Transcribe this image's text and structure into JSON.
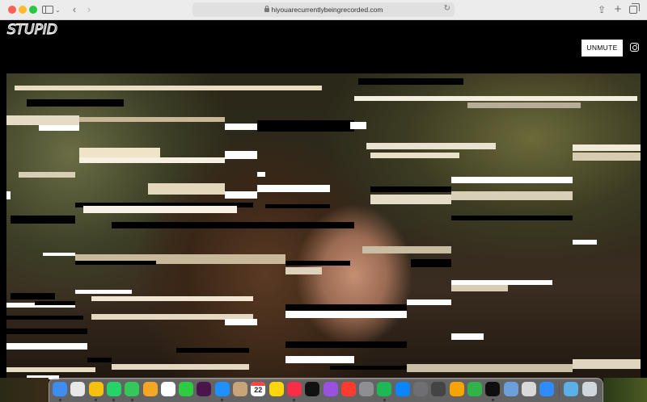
{
  "browser": {
    "url": "hiyouarecurrentlybeingrecorded.com"
  },
  "site": {
    "logo_text": "STUPID",
    "unmute_label": "UNMUTE"
  },
  "icons": {
    "sidebar": "sidebar-icon",
    "back": "chevron-left-icon",
    "forward": "chevron-right-icon",
    "lock": "lock-icon",
    "reload": "reload-icon",
    "share": "share-icon",
    "new_tab": "plus-icon",
    "tab_overview": "tabs-icon",
    "instagram": "instagram-icon"
  },
  "dock": {
    "calendar_day": "22",
    "apps": [
      {
        "name": "finder",
        "color": "#3d8ef0"
      },
      {
        "name": "launchpad",
        "color": "#e8e8e8"
      },
      {
        "name": "chrome",
        "color": "#f4c20d"
      },
      {
        "name": "whatsapp",
        "color": "#25d366"
      },
      {
        "name": "messages",
        "color": "#34c759"
      },
      {
        "name": "photos",
        "color": "#f5a623"
      },
      {
        "name": "reminders",
        "color": "#ffffff"
      },
      {
        "name": "facetime",
        "color": "#2ecc40"
      },
      {
        "name": "slack",
        "color": "#4a154b"
      },
      {
        "name": "safari",
        "color": "#1e90ff"
      },
      {
        "name": "contacts",
        "color": "#c9a37a"
      },
      {
        "name": "calendar",
        "color": "#ffffff"
      },
      {
        "name": "notes",
        "color": "#ffd60a"
      },
      {
        "name": "music",
        "color": "#fa2d48"
      },
      {
        "name": "tv",
        "color": "#111111"
      },
      {
        "name": "podcasts",
        "color": "#9b51e0"
      },
      {
        "name": "news",
        "color": "#ff3b30"
      },
      {
        "name": "settings",
        "color": "#8e8e93"
      },
      {
        "name": "spotify",
        "color": "#1db954"
      },
      {
        "name": "app-store",
        "color": "#0a84ff"
      },
      {
        "name": "quicktime",
        "color": "#6e6e73"
      },
      {
        "name": "calculator",
        "color": "#444444"
      },
      {
        "name": "pages",
        "color": "#f7a400"
      },
      {
        "name": "numbers",
        "color": "#2fb44a"
      },
      {
        "name": "stupid-app",
        "color": "#0f0f0f"
      },
      {
        "name": "preview",
        "color": "#6ca0dc"
      },
      {
        "name": "image-capture",
        "color": "#d9d9d9"
      },
      {
        "name": "zoom",
        "color": "#2d8cff"
      },
      {
        "name": "downloads-folder",
        "color": "#5ab0e8"
      },
      {
        "name": "trash",
        "color": "#cfd6dc"
      }
    ]
  }
}
